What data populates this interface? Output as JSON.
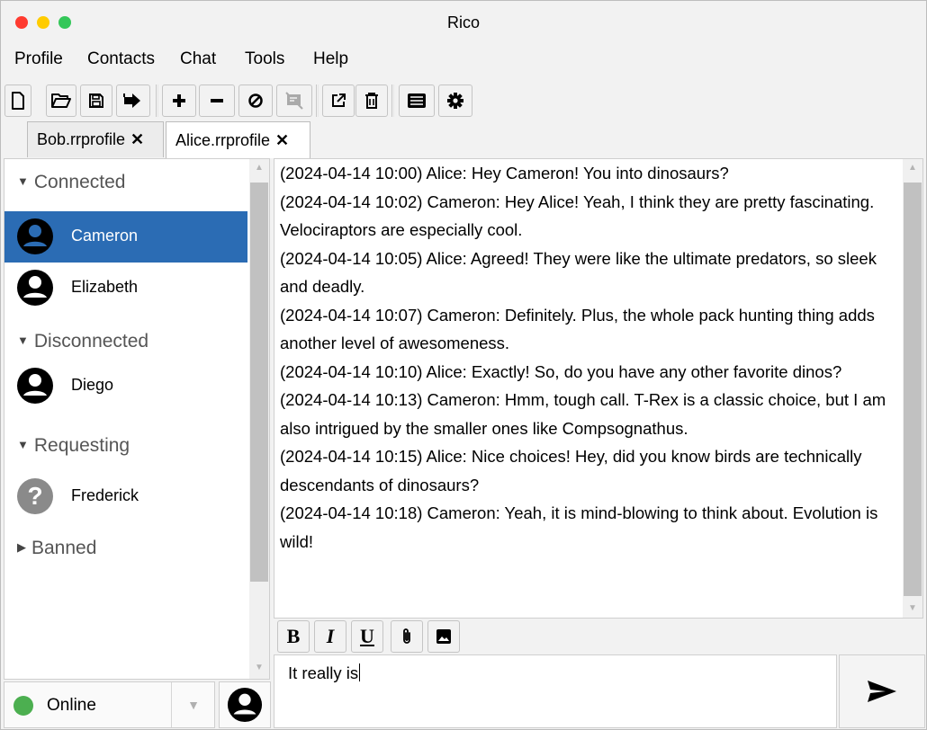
{
  "window": {
    "title": "Rico",
    "traffic_lights": [
      "#ff3b30",
      "#ffcc00",
      "#34c759"
    ]
  },
  "menu": {
    "items": [
      {
        "label": "Profile"
      },
      {
        "label": "Contacts"
      },
      {
        "label": "Chat"
      },
      {
        "label": "Tools"
      },
      {
        "label": "Help"
      }
    ]
  },
  "toolbar": {
    "buttons": [
      "new-file-icon",
      "open-folder-icon",
      "save-icon",
      "sign-out-icon",
      "add-icon",
      "remove-icon",
      "block-icon",
      "hide-message-icon",
      "external-window-icon",
      "trash-icon",
      "list-icon",
      "gear-icon"
    ]
  },
  "tabs": [
    {
      "label": "Bob.rrprofile",
      "close": "✕"
    },
    {
      "label": "Alice.rrprofile",
      "close": "✕"
    }
  ],
  "contacts": {
    "groups": [
      {
        "label": "Connected",
        "caret": "▼",
        "contacts": [
          {
            "name": "Cameron"
          },
          {
            "name": "Elizabeth"
          }
        ]
      },
      {
        "label": "Disconnected",
        "caret": "▼",
        "contacts": [
          {
            "name": "Diego"
          }
        ]
      },
      {
        "label": "Requesting",
        "caret": "▼",
        "contacts": [
          {
            "name": "Frederick"
          }
        ]
      },
      {
        "label": "Banned",
        "caret": "▶",
        "contacts": []
      }
    ]
  },
  "status": {
    "label": "Online",
    "color": "#4caf50"
  },
  "chat": {
    "messages": [
      "(2024-04-14 10:00) Alice: Hey Cameron! You into dinosaurs?",
      "(2024-04-14 10:02) Cameron: Hey Alice! Yeah, I think they are pretty fascinating. Velociraptors are especially cool.",
      "(2024-04-14 10:05) Alice: Agreed! They were like the ultimate predators, so sleek and deadly.",
      "(2024-04-14 10:07) Cameron: Definitely. Plus, the whole pack hunting thing adds another level of awesomeness.",
      "(2024-04-14 10:10) Alice: Exactly! So, do you have any other favorite dinos?",
      "(2024-04-14 10:13) Cameron: Hmm, tough call. T-Rex is a classic choice, but I am also intrigued by the smaller ones like Compsognathus.",
      "(2024-04-14 10:15) Alice: Nice choices! Hey, did you know birds are technically descendants of dinosaurs?",
      "(2024-04-14 10:18) Cameron: Yeah, it is mind-blowing to think about. Evolution is wild!"
    ]
  },
  "format": {
    "bold": "B",
    "italic": "I",
    "underline": "U"
  },
  "input": {
    "value": "It really is"
  },
  "colors": {
    "selection": "#2b6cb4"
  }
}
